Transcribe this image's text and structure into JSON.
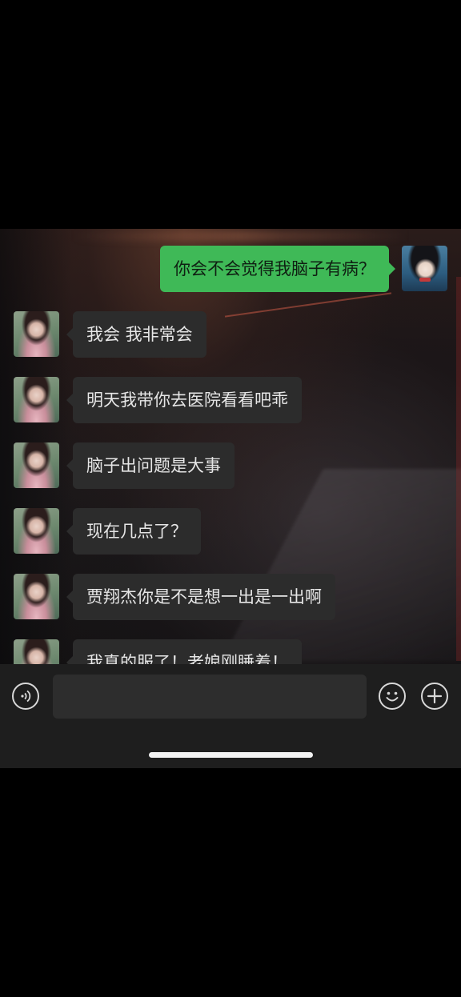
{
  "messages": [
    {
      "from": "me",
      "text": "你会不会觉得我脑子有病？"
    },
    {
      "from": "her",
      "text": "我会 我非常会"
    },
    {
      "from": "her",
      "text": "明天我带你去医院看看吧乖"
    },
    {
      "from": "her",
      "text": "脑子出问题是大事"
    },
    {
      "from": "her",
      "text": "现在几点了？"
    },
    {
      "from": "her",
      "text": "贾翔杰你是不是想一出是一出啊"
    },
    {
      "from": "her",
      "text": "我真的服了！老娘刚睡着！"
    }
  ],
  "input": {
    "value": "",
    "voice_icon": "voice-icon",
    "emoji_icon": "emoji-icon",
    "plus_icon": "plus-icon"
  },
  "colors": {
    "outgoing_bubble": "#3fb957",
    "incoming_bubble": "#2c2c2c",
    "input_bar": "#1e1e1e"
  }
}
